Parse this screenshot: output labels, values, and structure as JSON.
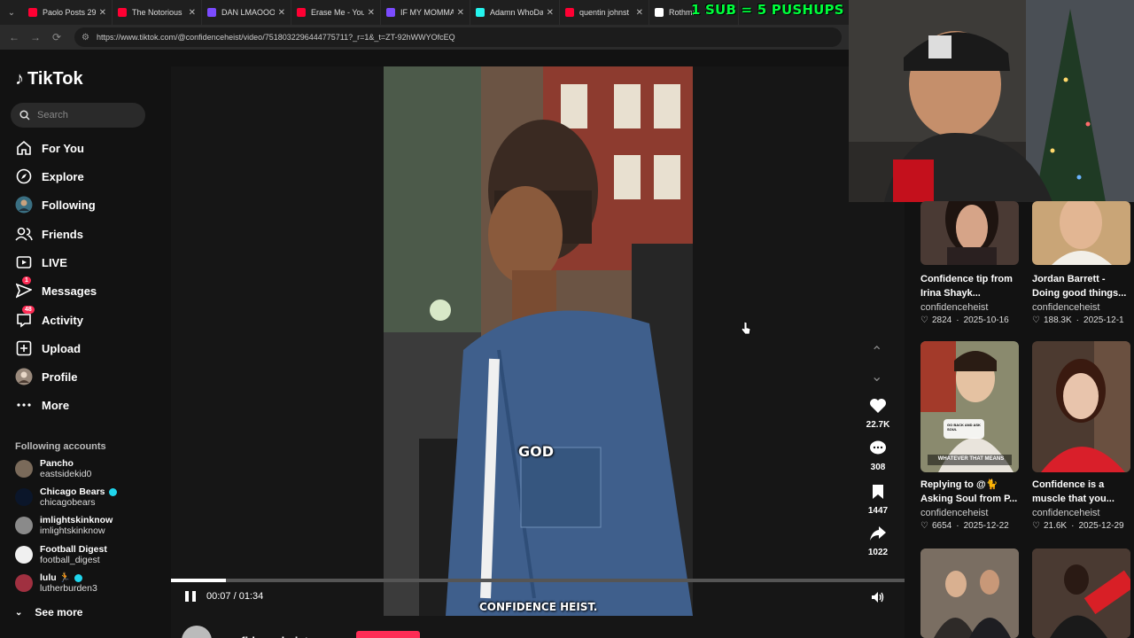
{
  "browser": {
    "tabs": [
      {
        "label": "Paolo Posts 29",
        "color": "#ff0033"
      },
      {
        "label": "The Notorious",
        "color": "#ff0033"
      },
      {
        "label": "DAN LMAOOO",
        "color": "#7b4bff"
      },
      {
        "label": "Erase Me - You",
        "color": "#ff0033"
      },
      {
        "label": "IF MY MOMMA",
        "color": "#7b4bff"
      },
      {
        "label": "Adamn WhoDa",
        "color": "#25f4ee"
      },
      {
        "label": "quentin johnst",
        "color": "#ff0033"
      },
      {
        "label": "Rothmu",
        "color": "#ffffff"
      }
    ],
    "url": "https://www.tiktok.com/@confidenceheist/video/7518032296444775711?_r=1&_t=ZT-92hWWYOfcEQ"
  },
  "overlay": {
    "sub_banner": "1 SUB = 5 PUSHUPS"
  },
  "sidebar": {
    "logo": "TikTok",
    "search_placeholder": "Search",
    "nav": [
      {
        "label": "For You",
        "icon": "home-icon"
      },
      {
        "label": "Explore",
        "icon": "compass-icon"
      },
      {
        "label": "Following",
        "icon": "avatar-icon"
      },
      {
        "label": "Friends",
        "icon": "friends-icon"
      },
      {
        "label": "LIVE",
        "icon": "live-icon"
      },
      {
        "label": "Messages",
        "icon": "messages-icon",
        "badge": "1"
      },
      {
        "label": "Activity",
        "icon": "activity-icon",
        "badge": "48"
      },
      {
        "label": "Upload",
        "icon": "upload-icon"
      },
      {
        "label": "Profile",
        "icon": "profile-icon"
      },
      {
        "label": "More",
        "icon": "more-icon"
      }
    ],
    "following_title": "Following accounts",
    "accounts": [
      {
        "name": "Pancho",
        "handle": "eastsidekid0",
        "verified": false,
        "color": "#7a6a5a"
      },
      {
        "name": "Chicago Bears",
        "handle": "chicagobears",
        "verified": true,
        "color": "#0b162a"
      },
      {
        "name": "imlightskinknow",
        "handle": "imlightskinknow",
        "verified": false,
        "color": "#8a8a8a"
      },
      {
        "name": "Football Digest",
        "handle": "football_digest",
        "verified": false,
        "color": "#f0f0f0"
      },
      {
        "name": "lulu 🏃",
        "handle": "lutherburden3",
        "verified": true,
        "color": "#a03040"
      }
    ],
    "see_more": "See more"
  },
  "player": {
    "caption_top": "GOD",
    "caption_bottom": "CONFIDENCE HEIST.",
    "time": "00:07 / 01:34",
    "progress": 0.075,
    "likes": "22.7K",
    "comments": "308",
    "saves": "1447",
    "shares": "1022",
    "author": "confidenceheist"
  },
  "recommended": [
    {
      "title": "Confidence tip from",
      "title2": "Irina Shayk...",
      "author": "confidenceheist",
      "likes": "2824",
      "date": "2025-10-16"
    },
    {
      "title": "Jordan Barrett -",
      "title2": "Doing good things...",
      "author": "confidenceheist",
      "likes": "188.3K",
      "date": "2025-12-1"
    },
    {
      "title": "Replying to @🐈",
      "title2": "Asking Soul from P...",
      "author": "confidenceheist",
      "likes": "6654",
      "date": "2025-12-22"
    },
    {
      "title": "Confidence is a",
      "title2": "muscle that you...",
      "author": "confidenceheist",
      "likes": "21.6K",
      "date": "2025-12-29"
    }
  ],
  "thumb_text": {
    "c3_top": "GO BACK AND ASK SOUL",
    "c3_bottom": "WHATEVER THAT MEANS"
  }
}
